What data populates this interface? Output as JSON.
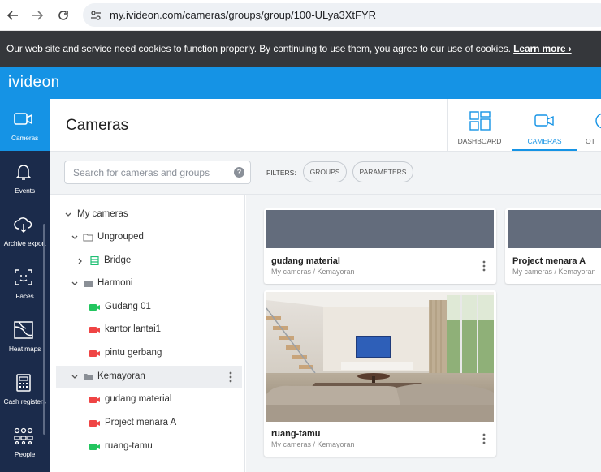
{
  "browser": {
    "url": "my.ivideon.com/cameras/groups/group/100-ULya3XtFYR"
  },
  "cookie_banner": {
    "text": "Our web site and service need cookies to function properly. By continuing to use them, you agree to our use of cookies.",
    "link": "Learn more ›"
  },
  "brand": {
    "logo": "ivideon"
  },
  "sidebar": {
    "items": [
      {
        "label": "Cameras",
        "icon": "video-camera-icon"
      },
      {
        "label": "Events",
        "icon": "bell-icon"
      },
      {
        "label": "Archive export",
        "icon": "cloud-download-icon"
      },
      {
        "label": "Faces",
        "icon": "face-scan-icon"
      },
      {
        "label": "Heat maps",
        "icon": "heat-map-icon"
      },
      {
        "label": "Cash registers",
        "icon": "cash-register-icon"
      },
      {
        "label": "People",
        "icon": "people-icon"
      }
    ]
  },
  "header": {
    "title": "Cameras",
    "tabs": [
      {
        "label": "DASHBOARD",
        "icon": "dashboard-grid-icon"
      },
      {
        "label": "CAMERAS",
        "icon": "video-camera-icon",
        "active": true
      },
      {
        "label": "OT",
        "icon": "partial-icon"
      }
    ]
  },
  "filterbar": {
    "search_placeholder": "Search for cameras and groups",
    "help": "?",
    "filters_label": "FILTERS:",
    "groups_label": "GROUPS",
    "parameters_label": "PARAMETERS"
  },
  "tree": {
    "root": "My cameras",
    "ungrouped": "Ungrouped",
    "bridge": "Bridge",
    "harmoni": "Harmoni",
    "harmoni_cams": [
      {
        "name": "Gudang 01",
        "status": "online"
      },
      {
        "name": "kantor lantai1",
        "status": "offline"
      },
      {
        "name": "pintu gerbang",
        "status": "offline"
      }
    ],
    "kemayoran": "Kemayoran",
    "kemayoran_cams": [
      {
        "name": "gudang material",
        "status": "offline"
      },
      {
        "name": "Project menara A",
        "status": "offline"
      },
      {
        "name": "ruang-tamu",
        "status": "online"
      }
    ]
  },
  "cards": [
    {
      "name": "gudang material",
      "path": "My cameras / Kemayoran"
    },
    {
      "name": "Project menara A",
      "path": "My cameras / Kemayoran"
    },
    {
      "name": "ruang-tamu",
      "path": "My cameras / Kemayoran"
    }
  ],
  "colors": {
    "accent": "#1593e5",
    "sidebar": "#1b2b4b",
    "online": "#22c55e",
    "offline": "#ef4444",
    "bridge": "#1fbf73"
  }
}
